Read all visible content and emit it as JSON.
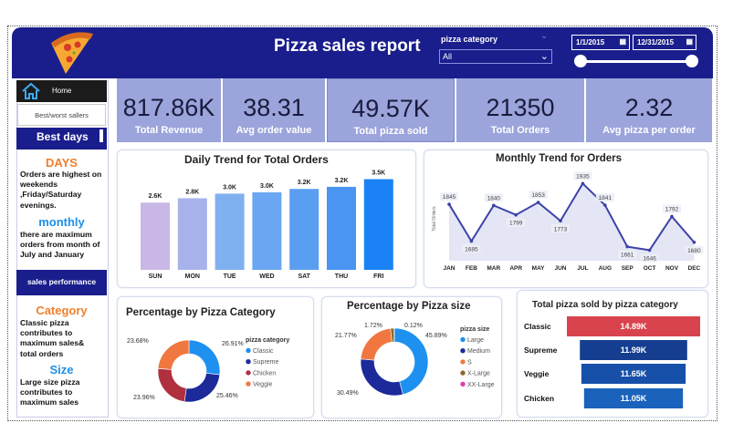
{
  "header": {
    "title": "Pizza sales report",
    "filter_label": "pizza category",
    "filter_value": "All",
    "date_start": "1/1/2015",
    "date_end": "12/31/2015",
    "colors": {
      "navy": "#1a1e8c",
      "kpi_bg": "#9ba4db"
    }
  },
  "nav": {
    "home": "Home",
    "best_worst": "Best/worst sallers",
    "best_days": "Best days",
    "sales_performance": "sales performance"
  },
  "notes": {
    "days_head": "DAYS",
    "days_lines": [
      "Orders are highest on",
      "weekends",
      ",Friday/Saturday",
      "evenings."
    ],
    "monthly_head": "monthly",
    "monthly_lines": [
      "there are maximum",
      "orders from month of",
      "July and January"
    ],
    "category_head": "Category",
    "category_lines": [
      "Classic pizza",
      "contributes to",
      "maximum sales&",
      "total orders"
    ],
    "size_head": "Size",
    "size_lines": [
      "Large size pizza",
      "contributes to",
      "maximum sales"
    ]
  },
  "kpis": [
    {
      "value": "817.86K",
      "label": "Total Revenue"
    },
    {
      "value": "38.31",
      "label": "Avg order value"
    },
    {
      "value": "49.57K",
      "label": "Total pizza sold"
    },
    {
      "value": "21350",
      "label": "Total Orders"
    },
    {
      "value": "2.32",
      "label": "Avg pizza per order"
    }
  ],
  "chart_data": [
    {
      "type": "bar",
      "title": "Daily Trend for Total Orders",
      "categories": [
        "SUN",
        "MON",
        "TUE",
        "WED",
        "SAT",
        "THU",
        "FRI"
      ],
      "values": [
        2624,
        2794,
        2973,
        3024,
        3158,
        3239,
        3538
      ],
      "labels": [
        "2.6K",
        "2.8K",
        "3.0K",
        "3.0K",
        "3.2K",
        "3.2K",
        "3.5K"
      ],
      "colors": [
        "#c9b8e6",
        "#a8b2ea",
        "#7fb0f0",
        "#6aa6f2",
        "#5a9ef2",
        "#4a94f2",
        "#1a82f4"
      ]
    },
    {
      "type": "area",
      "title": "Monthly Trend for Orders",
      "ylabel": "Total Orders",
      "x": [
        "JAN",
        "FEB",
        "MAR",
        "APR",
        "MAY",
        "JUN",
        "JUL",
        "AUG",
        "SEP",
        "OCT",
        "NOV",
        "DEC"
      ],
      "values": [
        1845,
        1685,
        1840,
        1799,
        1853,
        1773,
        1935,
        1841,
        1661,
        1646,
        1792,
        1680
      ],
      "ylim": [
        1600,
        1960
      ],
      "color": "#3c42a8"
    },
    {
      "type": "pie",
      "title": "Percentage by Pizza Category",
      "legend_title": "pizza category",
      "labels": [
        "Classic",
        "Supreme",
        "Chicken",
        "Veggie"
      ],
      "values": [
        26.91,
        25.46,
        23.96,
        23.68
      ],
      "value_labels": [
        "26.91%",
        "25.46%",
        "23.96%",
        "23.68%"
      ],
      "colors": [
        "#1e90f0",
        "#1c2a9a",
        "#b03040",
        "#f07840"
      ]
    },
    {
      "type": "pie",
      "title": "Percentage by Pizza size",
      "legend_title": "pizza size",
      "labels": [
        "Large",
        "Medium",
        "S",
        "X-Large",
        "XX-Large"
      ],
      "values": [
        45.89,
        30.49,
        21.77,
        1.72,
        0.12
      ],
      "value_labels": [
        "45.89%",
        "30.49%",
        "21.77%",
        "1.72%",
        "0.12%"
      ],
      "colors": [
        "#1e90f0",
        "#1c2a9a",
        "#f07840",
        "#8a6a2a",
        "#e040b0"
      ]
    },
    {
      "type": "bar",
      "title": "Total pizza sold by pizza category",
      "categories": [
        "Classic",
        "Supreme",
        "Veggie",
        "Chicken"
      ],
      "values": [
        14888,
        11987,
        11649,
        11050
      ],
      "labels": [
        "14.89K",
        "11.99K",
        "11.65K",
        "11.05K"
      ],
      "colors": [
        "#d9434e",
        "#153e90",
        "#1750a8",
        "#1a62bc"
      ]
    }
  ]
}
